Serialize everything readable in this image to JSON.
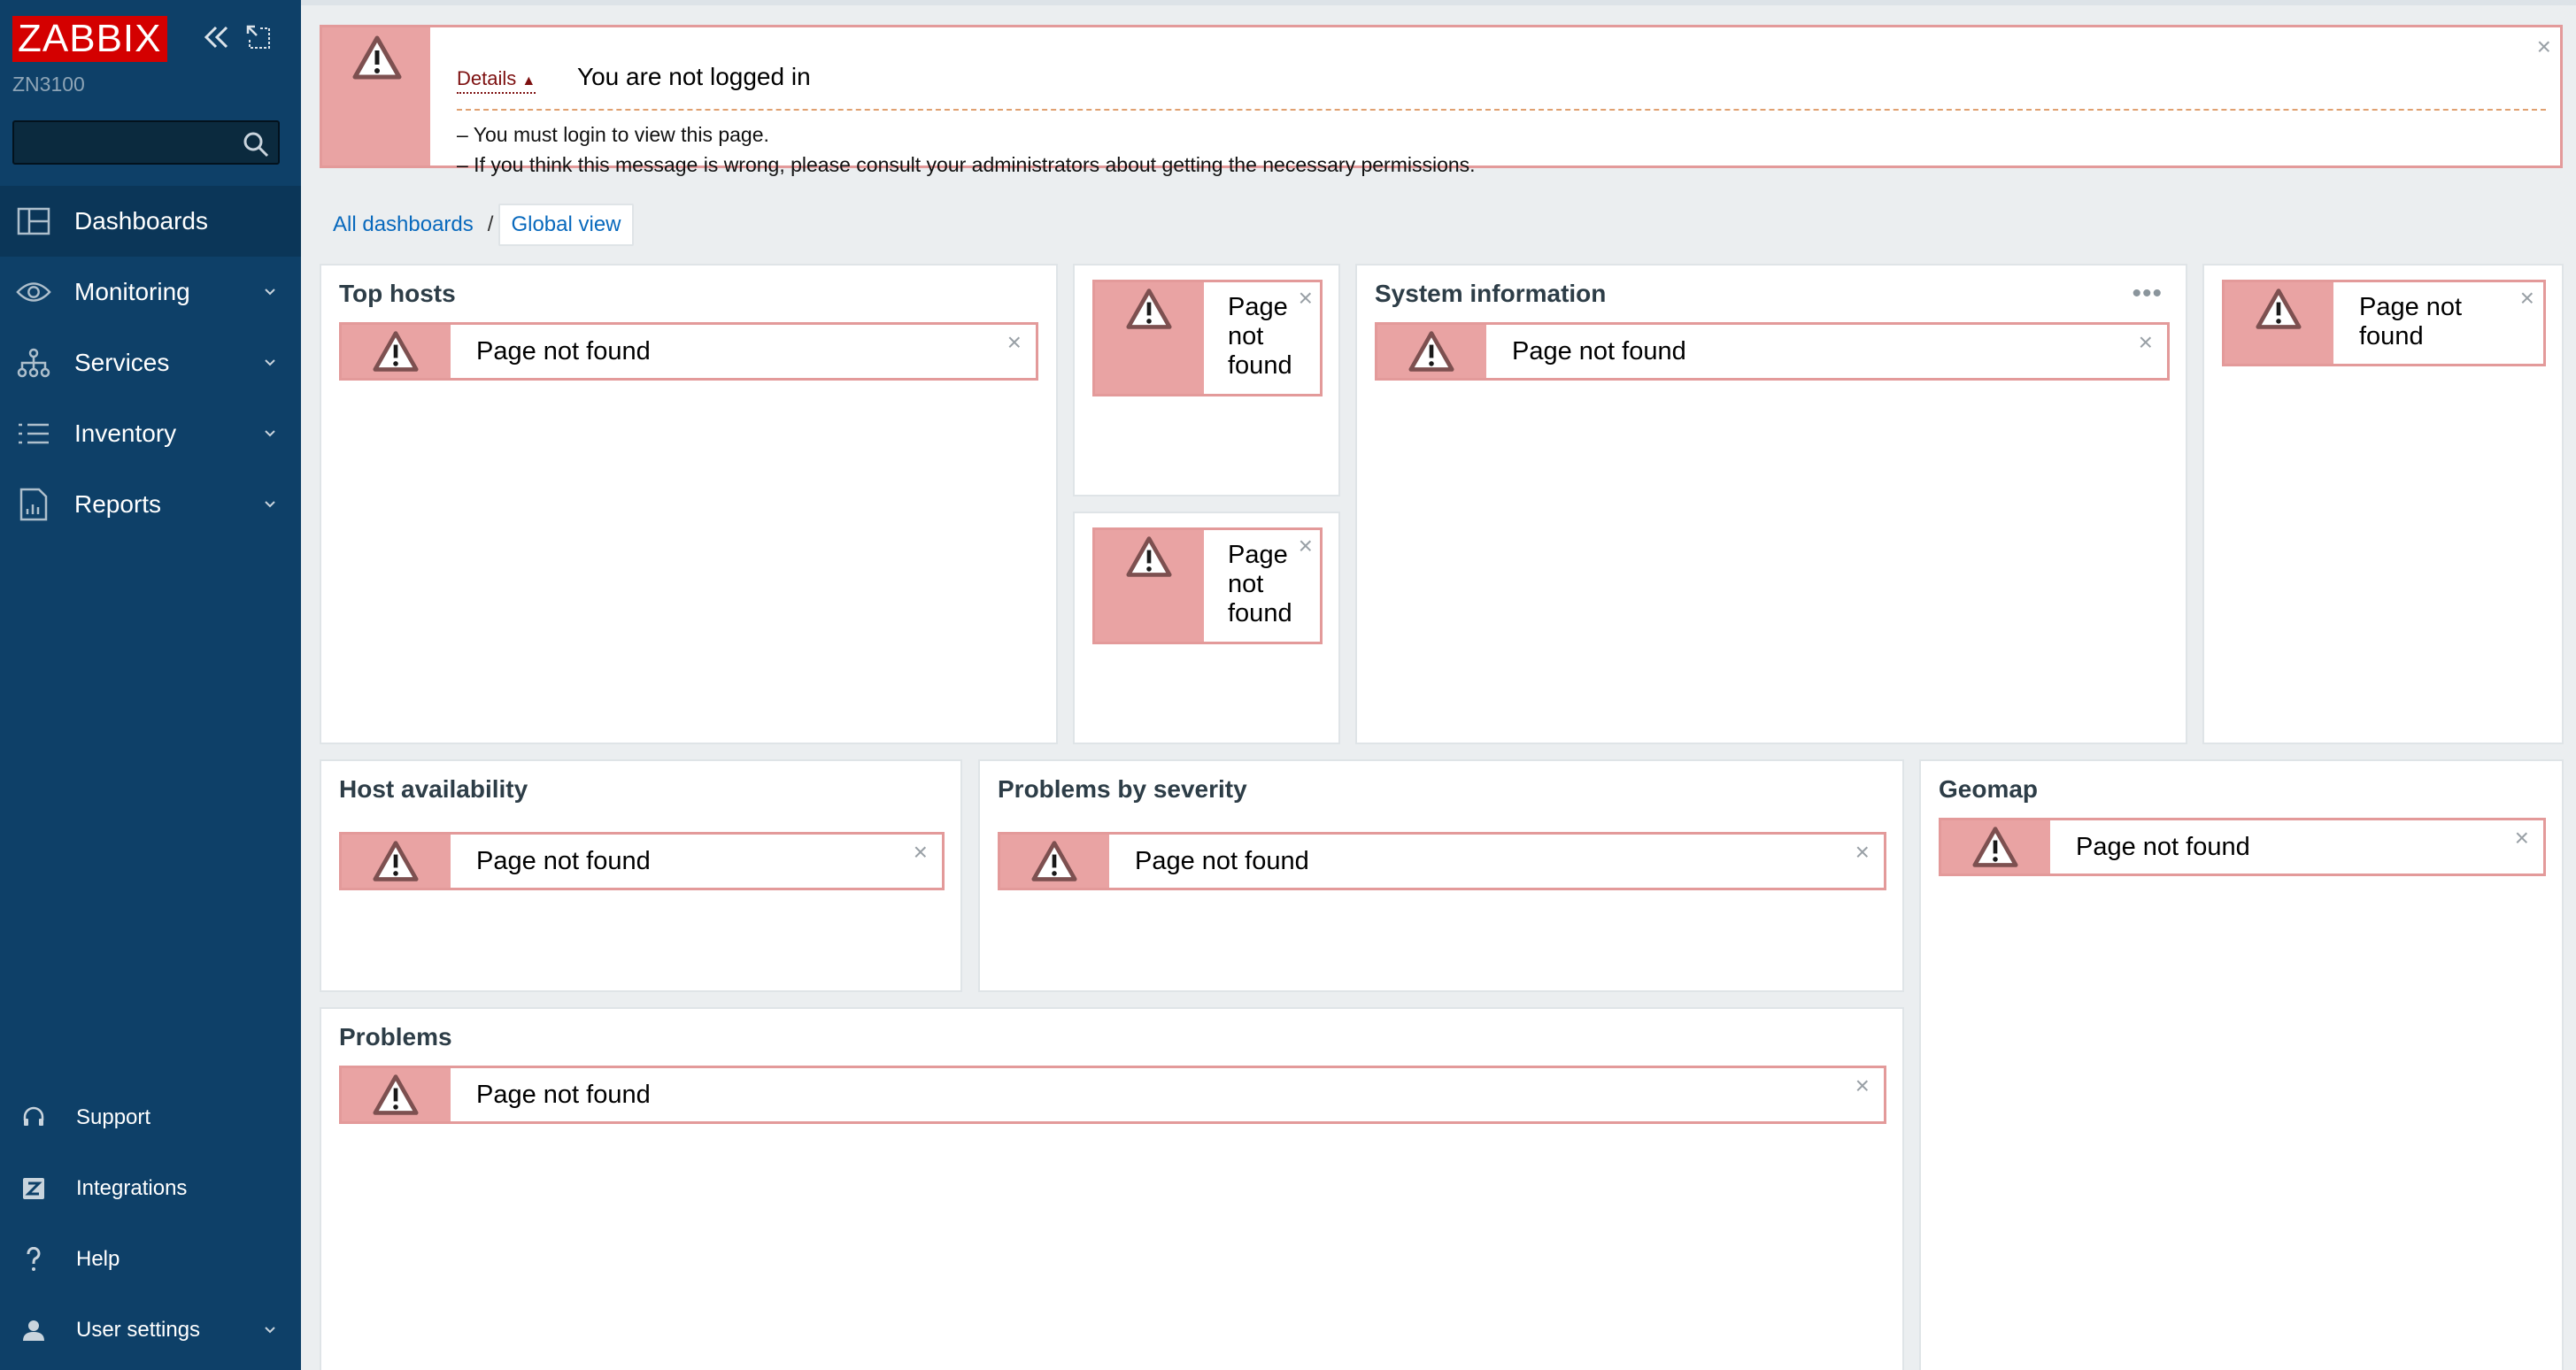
{
  "brand": {
    "logo_text": "ZABBIX",
    "server_name": "ZN3100",
    "accent_color": "#d40000",
    "sidebar_bg": "#0e4068"
  },
  "search": {
    "value": "",
    "icon": "search-icon"
  },
  "sidebar": {
    "items": [
      {
        "label": "Dashboards",
        "icon": "dashboard-icon",
        "active": true,
        "expandable": false
      },
      {
        "label": "Monitoring",
        "icon": "eye-icon",
        "active": false,
        "expandable": true
      },
      {
        "label": "Services",
        "icon": "services-icon",
        "active": false,
        "expandable": true
      },
      {
        "label": "Inventory",
        "icon": "list-icon",
        "active": false,
        "expandable": true
      },
      {
        "label": "Reports",
        "icon": "report-icon",
        "active": false,
        "expandable": true
      }
    ],
    "bottom_items": [
      {
        "label": "Support",
        "icon": "headset-icon",
        "expandable": false
      },
      {
        "label": "Integrations",
        "icon": "integrations-icon",
        "expandable": false
      },
      {
        "label": "Help",
        "icon": "help-icon",
        "expandable": false
      },
      {
        "label": "User settings",
        "icon": "user-icon",
        "expandable": true
      }
    ]
  },
  "global_message": {
    "details_label": "Details",
    "title": "You are not logged in",
    "lines": [
      "–  You must login to view this page.",
      "–  If you think this message is wrong, please consult your administrators about getting the necessary permissions."
    ],
    "error_color": "#e9a3a3"
  },
  "breadcrumb": {
    "parent": "All dashboards",
    "separator": "/",
    "current": "Global view"
  },
  "widgets": {
    "top_hosts": {
      "title": "Top hosts",
      "error": "Page not found"
    },
    "small_a": {
      "error_lines": [
        "Page",
        "not",
        "found"
      ]
    },
    "small_b": {
      "error_lines": [
        "Page",
        "not",
        "found"
      ]
    },
    "system_information": {
      "title": "System information",
      "error": "Page not found"
    },
    "right_top": {
      "error_lines": [
        "Page not",
        "found"
      ]
    },
    "host_availability": {
      "title": "Host availability",
      "error": "Page not found"
    },
    "problems_by_severity": {
      "title": "Problems by severity",
      "error": "Page not found"
    },
    "geomap": {
      "title": "Geomap",
      "error": "Page not found"
    },
    "problems": {
      "title": "Problems",
      "error": "Page not found"
    }
  },
  "close_glyph": "×",
  "more_glyph": "•••"
}
